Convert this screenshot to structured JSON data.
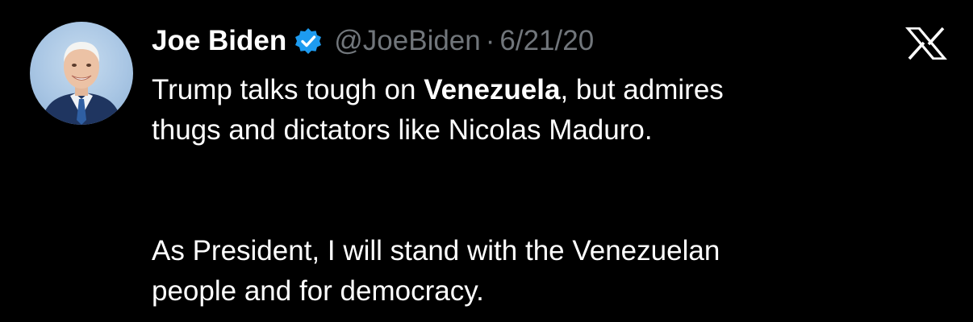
{
  "tweet": {
    "author_name": "Joe Biden",
    "handle": "@JoeBiden",
    "separator": "·",
    "date": "6/21/20",
    "avatar_icon": "profile-photo",
    "verified_icon": "verified-badge-icon",
    "logo_icon": "x-logo-icon",
    "text": {
      "line1_prefix": "Trump talks tough on ",
      "line1_bold": "Venezuela",
      "line1_suffix": ", but admires",
      "line2": "thugs and dictators like Nicolas Maduro.",
      "paragraph2_line1": "As President, I will stand with the Venezuelan",
      "paragraph2_line2": "people and for democracy."
    }
  },
  "colors": {
    "background": "#000000",
    "text": "#ffffff",
    "secondary": "#71767b",
    "verified": "#1d9bf0"
  }
}
